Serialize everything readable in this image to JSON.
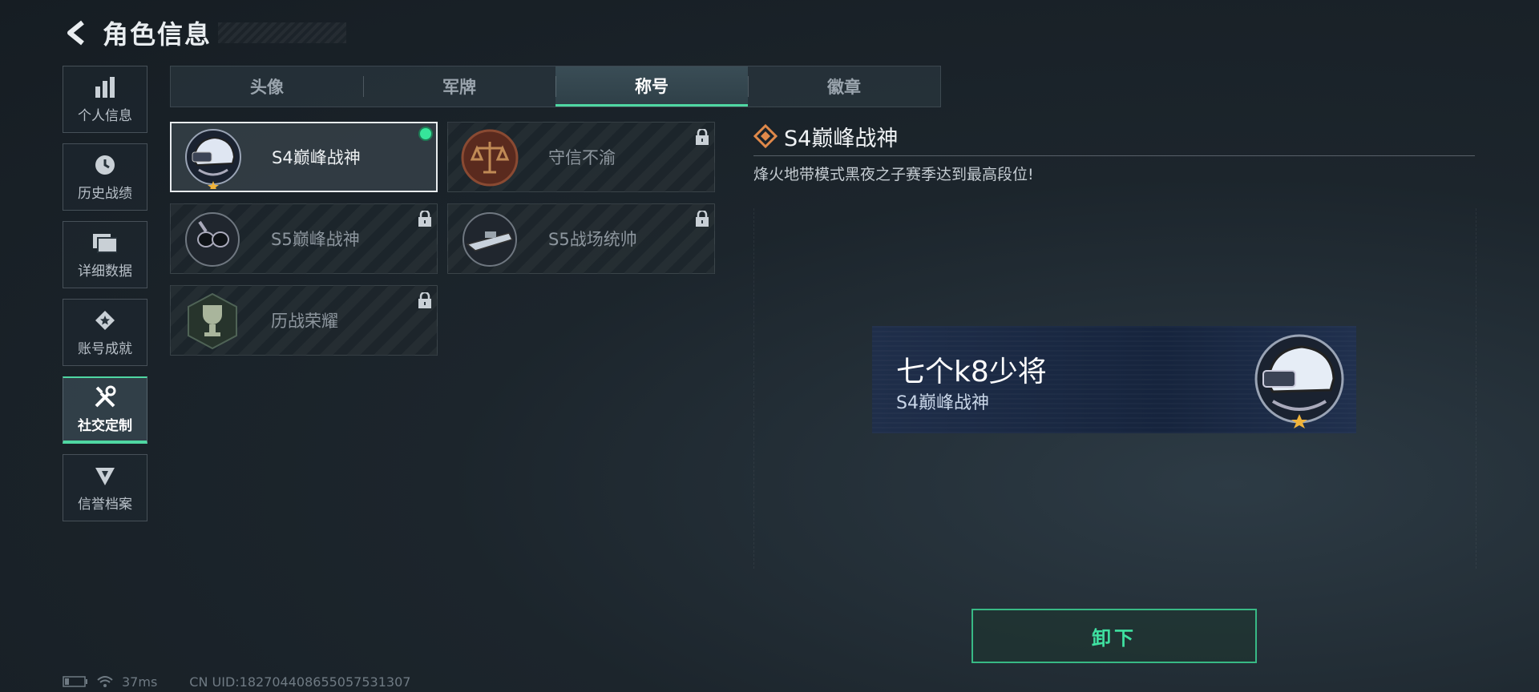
{
  "header": {
    "title": "角色信息"
  },
  "sidebar": {
    "items": [
      {
        "label": "个人信息",
        "icon": "bar-chart-icon"
      },
      {
        "label": "历史战绩",
        "icon": "clock-icon"
      },
      {
        "label": "详细数据",
        "icon": "folder-icon"
      },
      {
        "label": "账号成就",
        "icon": "achievement-icon"
      },
      {
        "label": "社交定制",
        "icon": "tools-icon",
        "active": true
      },
      {
        "label": "信誉档案",
        "icon": "shield-icon"
      }
    ]
  },
  "tabs": [
    {
      "label": "头像"
    },
    {
      "label": "军牌"
    },
    {
      "label": "称号",
      "active": true
    },
    {
      "label": "徽章"
    }
  ],
  "titles": [
    {
      "name": "S4巅峰战神",
      "icon": "helmet-nightvision-badge-icon",
      "selected": true,
      "equipped": true,
      "locked": false
    },
    {
      "name": "守信不渝",
      "icon": "scales-badge-icon",
      "locked": true
    },
    {
      "name": "S5巅峰战神",
      "icon": "diving-mask-badge-icon",
      "locked": true
    },
    {
      "name": "S5战场统帅",
      "icon": "boat-badge-icon",
      "locked": true
    },
    {
      "name": "历战荣耀",
      "icon": "trophy-badge-icon",
      "locked": true
    }
  ],
  "detail": {
    "title": "S4巅峰战神",
    "description": "烽火地带模式黑夜之子赛季达到最高段位!"
  },
  "banner": {
    "player_name": "七个k8少将",
    "title": "S4巅峰战神"
  },
  "actions": {
    "unequip_label": "卸下"
  },
  "status": {
    "ping": "37ms",
    "uid": "CN UID:1827044086550575313​07"
  },
  "colors": {
    "accent": "#4fd7a2",
    "equipped_dot": "#36e59a",
    "diamond": "#e0894a"
  }
}
